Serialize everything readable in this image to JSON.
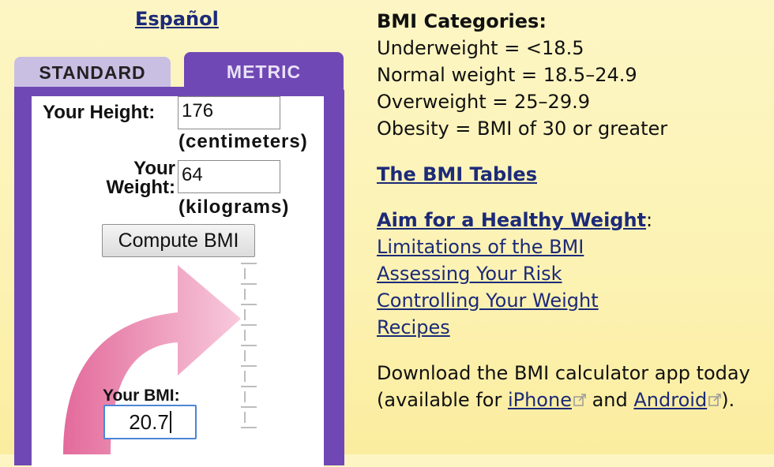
{
  "language_link": "Español",
  "tabs": {
    "standard": "STANDARD",
    "metric": "METRIC"
  },
  "form": {
    "height_label": "Your Height:",
    "height_value": "176",
    "height_unit": "(centimeters)",
    "weight_label_1": "Your",
    "weight_label_2": "Weight:",
    "weight_value": "64",
    "weight_unit": "(kilograms)",
    "compute_button": "Compute BMI",
    "result_label": "Your BMI:",
    "result_value": "20.7"
  },
  "categories": {
    "heading": "BMI Categories:",
    "items": [
      "Underweight = <18.5",
      "Normal weight = 18.5–24.9",
      "Overweight = 25–29.9",
      "Obesity = BMI of 30 or greater"
    ]
  },
  "links": {
    "bmi_tables": "The BMI Tables",
    "healthy_weight": "Aim for a Healthy Weight",
    "healthy_weight_colon": ":",
    "sublinks": [
      "Limitations of the BMI",
      "Assessing Your Risk",
      "Controlling Your Weight",
      "Recipes"
    ]
  },
  "download": {
    "line1": "Download the BMI calculator app today",
    "line2_prefix": "(available for ",
    "iphone": "iPhone",
    "and": " and ",
    "android": "Android",
    "suffix": ")."
  },
  "colors": {
    "tab_active": "#7048b5",
    "tab_inactive": "#c9bfe3",
    "link": "#1c2a78",
    "arrow": "#e05a90"
  }
}
